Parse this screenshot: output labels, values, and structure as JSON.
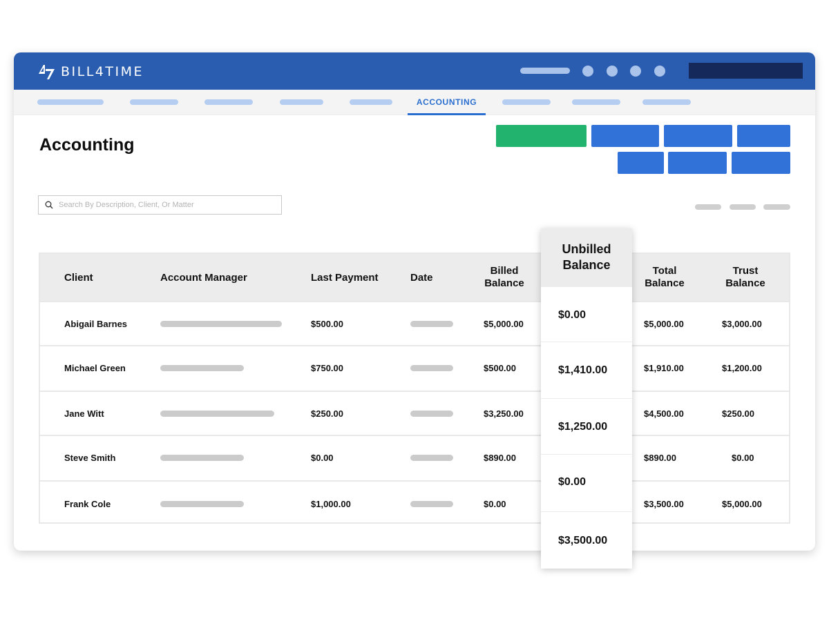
{
  "app": {
    "logo_text": "BILL4TIME"
  },
  "nav": {
    "active_tab": "ACCOUNTING"
  },
  "page": {
    "title": "Accounting"
  },
  "search": {
    "placeholder": "Search By Description, Client, Or Matter",
    "value": ""
  },
  "colors": {
    "header_blue": "#2a5db0",
    "accent_blue": "#2a6fcf",
    "button_blue": "#3172d8",
    "button_green": "#22b46e",
    "dark_navy": "#15295a"
  },
  "table": {
    "headers": {
      "client": "Client",
      "account_manager": "Account Manager",
      "last_payment": "Last Payment",
      "date": "Date",
      "billed_line1": "Billed",
      "billed_line2": "Balance",
      "unbilled_line1": "Unbilled",
      "unbilled_line2": "Balance",
      "total_line1": "Total",
      "total_line2": "Balance",
      "trust_line1": "Trust",
      "trust_line2": "Balance"
    },
    "rows": [
      {
        "client": "Abigail Barnes",
        "last_payment": "$500.00",
        "billed": "$5,000.00",
        "unbilled": "$0.00",
        "total": "$5,000.00",
        "trust": "$3,000.00"
      },
      {
        "client": "Michael Green",
        "last_payment": "$750.00",
        "billed": "$500.00",
        "unbilled": "$1,410.00",
        "total": "$1,910.00",
        "trust": "$1,200.00"
      },
      {
        "client": "Jane Witt",
        "last_payment": "$250.00",
        "billed": "$3,250.00",
        "unbilled": "$1,250.00",
        "total": "$4,500.00",
        "trust": "$250.00"
      },
      {
        "client": "Steve Smith",
        "last_payment": "$0.00",
        "billed": "$890.00",
        "unbilled": "$0.00",
        "total": "$890.00",
        "trust": "$0.00"
      },
      {
        "client": "Frank Cole",
        "last_payment": "$1,000.00",
        "billed": "$0.00",
        "unbilled": "$3,500.00",
        "total": "$3,500.00",
        "trust": "$5,000.00"
      }
    ]
  }
}
